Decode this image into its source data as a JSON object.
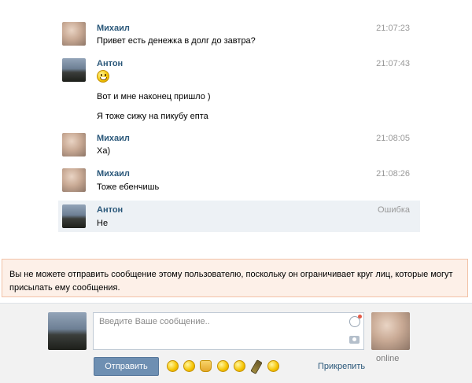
{
  "messages": [
    {
      "author": "Михаил",
      "time": "21:07:23",
      "lines": [
        "Привет есть денежка в долг до завтра?"
      ]
    },
    {
      "author": "Антон",
      "time": "21:07:43",
      "emoji": "grin-smile-icon",
      "lines": [
        "Вот и мне наконец пришло )",
        "Я тоже сижу на пикубу епта"
      ]
    },
    {
      "author": "Михаил",
      "time": "21:08:05",
      "lines": [
        "Ха)"
      ]
    },
    {
      "author": "Михаил",
      "time": "21:08:26",
      "lines": [
        "Тоже ебенчишь"
      ]
    },
    {
      "author": "Антон",
      "status": "Ошибка",
      "lines": [
        "Не"
      ]
    }
  ],
  "warning": {
    "text": "Вы не можете отправить сообщение этому пользователю, поскольку он ограничивает круг лиц, которые могут присылать ему сообщения."
  },
  "composer": {
    "placeholder": "Введите Ваше сообщение..",
    "send_label": "Отправить",
    "attach_label": "Прикрепить",
    "peer_status": "online",
    "quick_emojis": [
      "grin-icon",
      "kiss-wink-icon",
      "thumbs-up-icon",
      "wink-icon",
      "blush-icon",
      "champagne-icon",
      "neutral-face-icon"
    ]
  },
  "colors": {
    "author": "#2b587a",
    "error_row": "#edf1f5",
    "warning_bg": "#fdf0e8",
    "warning_border": "#f2c2a7",
    "send_button": "#6e8fb2"
  }
}
